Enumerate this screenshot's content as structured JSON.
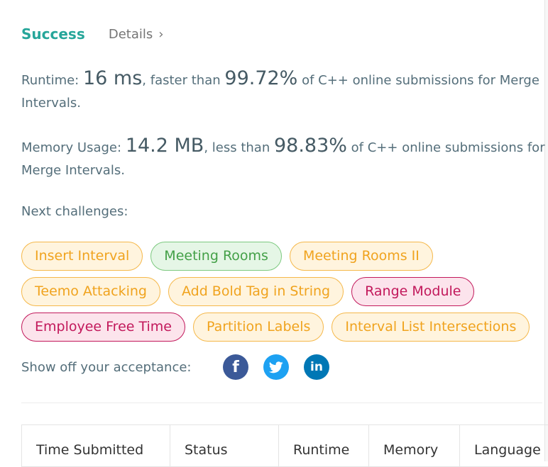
{
  "result": {
    "status": "Success",
    "details_label": "Details",
    "details_chevron": "›"
  },
  "runtime": {
    "label": "Runtime:",
    "value": "16 ms",
    "mid_text": ", faster than",
    "percent": "99.72%",
    "suffix": "of C++ online submissions for Merge Intervals."
  },
  "memory": {
    "label": "Memory Usage:",
    "value": "14.2 MB",
    "mid_text": ", less than",
    "percent": "98.83%",
    "suffix": "of C++ online submissions for Merge Intervals."
  },
  "next_challenges": {
    "label": "Next challenges:",
    "items": [
      {
        "title": "Insert Interval",
        "difficulty": "medium"
      },
      {
        "title": "Meeting Rooms",
        "difficulty": "easy"
      },
      {
        "title": "Meeting Rooms II",
        "difficulty": "medium"
      },
      {
        "title": "Teemo Attacking",
        "difficulty": "medium"
      },
      {
        "title": "Add Bold Tag in String",
        "difficulty": "medium"
      },
      {
        "title": "Range Module",
        "difficulty": "hard"
      },
      {
        "title": "Employee Free Time",
        "difficulty": "hard"
      },
      {
        "title": "Partition Labels",
        "difficulty": "medium"
      },
      {
        "title": "Interval List Intersections",
        "difficulty": "medium"
      }
    ]
  },
  "share": {
    "label": "Show off your acceptance:",
    "icons": [
      "facebook-icon",
      "twitter-icon",
      "linkedin-icon"
    ],
    "facebook_glyph": "f",
    "linkedin_glyph": "in"
  },
  "table": {
    "headers": [
      "Time Submitted",
      "Status",
      "Runtime",
      "Memory",
      "Language"
    ]
  },
  "colors": {
    "success": "#26a69a",
    "medium_tag": "#f0a31e",
    "easy_tag": "#43a047",
    "hard_tag": "#c2185b",
    "facebook": "#3b5998",
    "twitter": "#1da1f2",
    "linkedin": "#0077b5"
  }
}
